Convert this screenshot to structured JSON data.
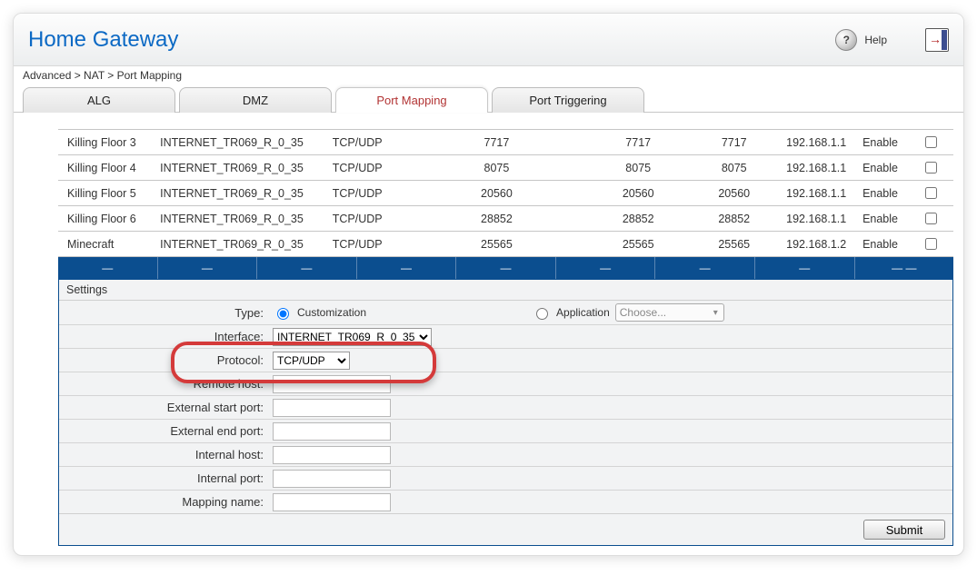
{
  "header": {
    "title": "Home Gateway",
    "help": "Help"
  },
  "breadcrumb": "Advanced > NAT > Port Mapping",
  "tabs": [
    {
      "label": "ALG",
      "active": false
    },
    {
      "label": "DMZ",
      "active": false
    },
    {
      "label": "Port Mapping",
      "active": true
    },
    {
      "label": "Port Triggering",
      "active": false
    }
  ],
  "rows": [
    {
      "name": "Killing Floor 3",
      "iface": "INTERNET_TR069_R_0_35",
      "proto": "TCP/UDP",
      "p1": "7717",
      "p2": "7717",
      "p3": "7717",
      "ip": "192.168.1.1",
      "status": "Enable"
    },
    {
      "name": "Killing Floor 4",
      "iface": "INTERNET_TR069_R_0_35",
      "proto": "TCP/UDP",
      "p1": "8075",
      "p2": "8075",
      "p3": "8075",
      "ip": "192.168.1.1",
      "status": "Enable"
    },
    {
      "name": "Killing Floor 5",
      "iface": "INTERNET_TR069_R_0_35",
      "proto": "TCP/UDP",
      "p1": "20560",
      "p2": "20560",
      "p3": "20560",
      "ip": "192.168.1.1",
      "status": "Enable"
    },
    {
      "name": "Killing Floor 6",
      "iface": "INTERNET_TR069_R_0_35",
      "proto": "TCP/UDP",
      "p1": "28852",
      "p2": "28852",
      "p3": "28852",
      "ip": "192.168.1.1",
      "status": "Enable"
    },
    {
      "name": "Minecraft",
      "iface": "INTERNET_TR069_R_0_35",
      "proto": "TCP/UDP",
      "p1": "25565",
      "p2": "25565",
      "p3": "25565",
      "ip": "192.168.1.2",
      "status": "Enable"
    }
  ],
  "bluebar": [
    "—",
    "—",
    "—",
    "—",
    "—",
    "—",
    "—",
    "—",
    "— —"
  ],
  "settings": {
    "panel_title": "Settings",
    "type_label": "Type:",
    "type_custom": "Customization",
    "type_app": "Application",
    "app_placeholder": "Choose...",
    "interface_label": "Interface:",
    "interface_value": "INTERNET_TR069_R_0_35",
    "protocol_label": "Protocol:",
    "protocol_value": "TCP/UDP",
    "remote_host_label": "Remote host:",
    "ext_start_label": "External start port:",
    "ext_end_label": "External end port:",
    "int_host_label": "Internal host:",
    "int_port_label": "Internal port:",
    "map_name_label": "Mapping name:",
    "submit": "Submit"
  }
}
